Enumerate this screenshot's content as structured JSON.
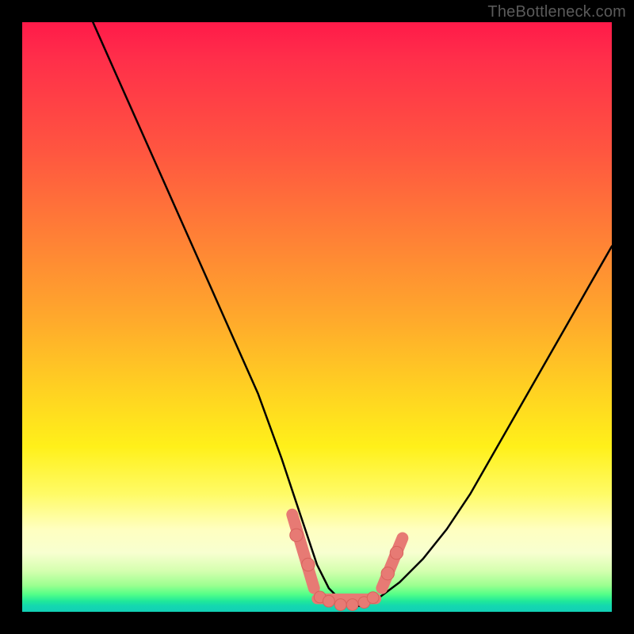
{
  "watermark": "TheBottleneck.com",
  "colors": {
    "frame": "#000000",
    "curve": "#000000",
    "marker_fill": "#e77a74",
    "marker_stroke": "#d8615c",
    "gradient_top": "#ff1a49",
    "gradient_mid": "#ffd022",
    "gradient_bottom": "#12d0b5"
  },
  "chart_data": {
    "type": "line",
    "title": "",
    "xlabel": "",
    "ylabel": "",
    "xlim": [
      0,
      100
    ],
    "ylim": [
      0,
      100
    ],
    "grid": false,
    "legend": false,
    "series": [
      {
        "name": "bottleneck-curve",
        "x": [
          12,
          16,
          20,
          24,
          28,
          32,
          36,
          40,
          44,
          46,
          48,
          50,
          52,
          54,
          56,
          58,
          60,
          64,
          68,
          72,
          76,
          80,
          84,
          88,
          92,
          96,
          100
        ],
        "y": [
          100,
          91,
          82,
          73,
          64,
          55,
          46,
          37,
          26,
          20,
          14,
          8,
          4,
          2,
          1,
          1,
          2,
          5,
          9,
          14,
          20,
          27,
          34,
          41,
          48,
          55,
          62
        ]
      }
    ],
    "markers": [
      {
        "name": "pt-left-upper",
        "x": 46.5,
        "y": 13,
        "r": 1.1
      },
      {
        "name": "pt-left-lower",
        "x": 48.5,
        "y": 8,
        "r": 1.1
      },
      {
        "name": "pt-bottom-1",
        "x": 50.5,
        "y": 2.5,
        "r": 1.0
      },
      {
        "name": "pt-bottom-2",
        "x": 52.0,
        "y": 1.8,
        "r": 1.0
      },
      {
        "name": "pt-bottom-3",
        "x": 54.0,
        "y": 1.2,
        "r": 1.0
      },
      {
        "name": "pt-bottom-4",
        "x": 56.0,
        "y": 1.2,
        "r": 1.0
      },
      {
        "name": "pt-bottom-5",
        "x": 58.0,
        "y": 1.6,
        "r": 1.0
      },
      {
        "name": "pt-bottom-6",
        "x": 59.5,
        "y": 2.4,
        "r": 1.0
      },
      {
        "name": "pt-right-lower",
        "x": 62.0,
        "y": 6.5,
        "r": 1.1
      },
      {
        "name": "pt-right-upper",
        "x": 63.5,
        "y": 10,
        "r": 1.1
      }
    ],
    "segments": [
      {
        "name": "seg-left",
        "x1": 45.8,
        "y1": 16.5,
        "x2": 49.5,
        "y2": 4.0,
        "w": 2.0
      },
      {
        "name": "seg-bottom",
        "x1": 50.0,
        "y1": 2.2,
        "x2": 60.0,
        "y2": 2.2,
        "w": 1.8
      },
      {
        "name": "seg-right",
        "x1": 61.0,
        "y1": 4.0,
        "x2": 64.5,
        "y2": 12.5,
        "w": 2.0
      }
    ]
  }
}
